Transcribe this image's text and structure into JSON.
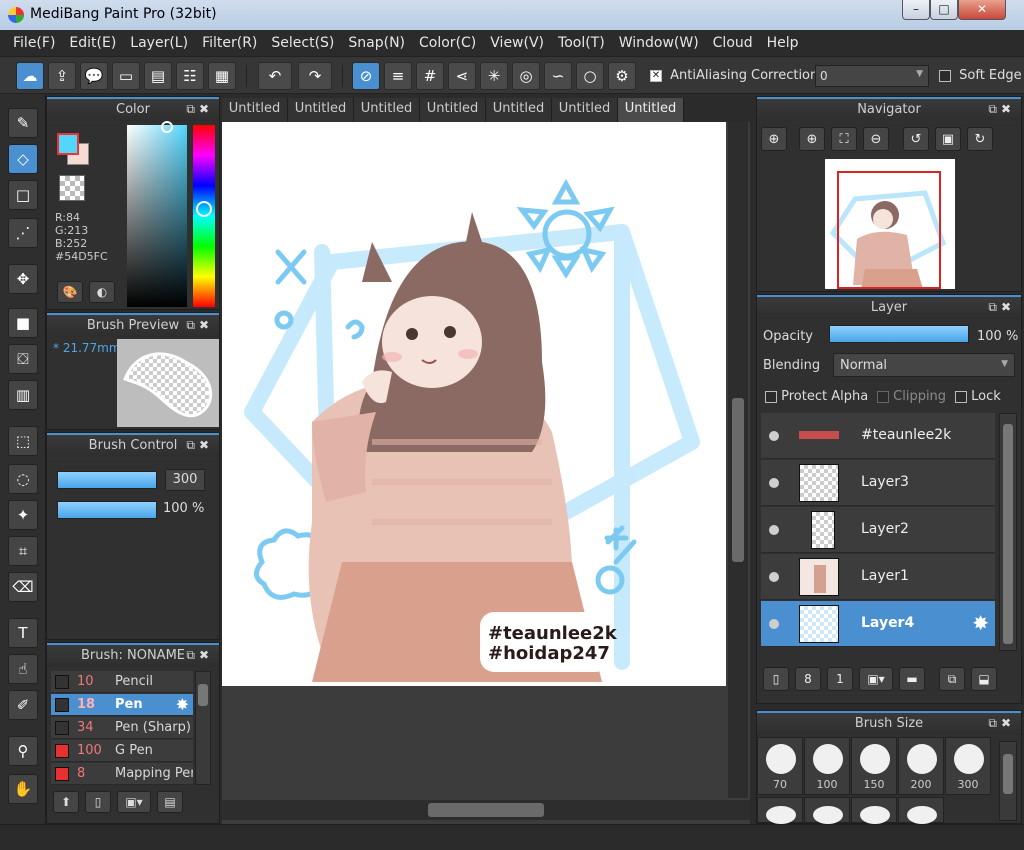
{
  "window": {
    "title": "MediBang Paint Pro (32bit)",
    "controls": {
      "minimize": "–",
      "maximize": "□",
      "close": "✕"
    }
  },
  "menu": [
    "File(F)",
    "Edit(E)",
    "Layer(L)",
    "Filter(R)",
    "Select(S)",
    "Snap(N)",
    "Color(C)",
    "View(V)",
    "Tool(T)",
    "Window(W)",
    "Cloud",
    "Help"
  ],
  "toolbar": {
    "antialiasing_label": "AntiAliasing",
    "antialiasing_checked": true,
    "correction_label": "Correction",
    "correction_value": "0",
    "soft_edge_label": "Soft Edge",
    "soft_edge_checked": false
  },
  "color_panel": {
    "title": "Color",
    "foreground": "#54D5FC",
    "r": "R:84",
    "g": "G:213",
    "b": "B:252",
    "hex": "#54D5FC"
  },
  "brush_preview": {
    "title": "Brush Preview",
    "size": "* 21.77mm"
  },
  "brush_control": {
    "title": "Brush Control",
    "size_value": "300",
    "opacity_value": "100 %"
  },
  "brush_list": {
    "title": "Brush: NONAME",
    "items": [
      {
        "size": "10",
        "name": "Pencil",
        "color": "#333333",
        "selected": false
      },
      {
        "size": "18",
        "name": "Pen",
        "color": "#333333",
        "selected": true
      },
      {
        "size": "34",
        "name": "Pen (Sharp)",
        "color": "#333333",
        "selected": false
      },
      {
        "size": "100",
        "name": "G Pen",
        "color": "#e83030",
        "selected": false
      },
      {
        "size": "8",
        "name": "Mapping Pen",
        "color": "#e83030",
        "selected": false
      }
    ]
  },
  "tabs": [
    "Untitled",
    "Untitled",
    "Untitled",
    "Untitled",
    "Untitled",
    "Untitled",
    "Untitled"
  ],
  "active_tab": 6,
  "canvas": {
    "watermark_line1": "#teaunlee2k",
    "watermark_line2": "#hoidap247"
  },
  "navigator": {
    "title": "Navigator"
  },
  "layer_panel": {
    "title": "Layer",
    "opacity_label": "Opacity",
    "opacity_value": "100 %",
    "blending_label": "Blending",
    "blending_value": "Normal",
    "protect_alpha_label": "Protect Alpha",
    "clipping_label": "Clipping",
    "lock_label": "Lock",
    "layers": [
      {
        "name": "#teaunlee2k",
        "selected": false
      },
      {
        "name": "Layer3",
        "selected": false
      },
      {
        "name": "Layer2",
        "selected": false
      },
      {
        "name": "Layer1",
        "selected": false
      },
      {
        "name": "Layer4",
        "selected": true
      }
    ]
  },
  "brush_size_panel": {
    "title": "Brush Size",
    "sizes": [
      "70",
      "100",
      "150",
      "200",
      "300"
    ]
  },
  "colors": {
    "accent": "#4a90d0",
    "panel_bg": "#303030",
    "app_bg": "#2b2b2b"
  }
}
